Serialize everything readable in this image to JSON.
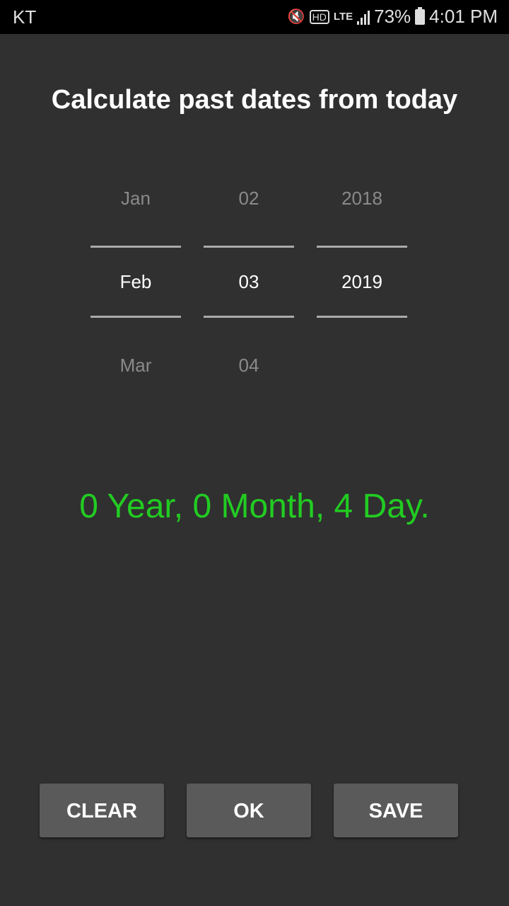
{
  "status_bar": {
    "carrier": "KT",
    "icons": [
      "mute-vibrate-icon",
      "hd-voice-icon",
      "lte-icon",
      "signal-icon",
      "battery-charging-icon"
    ],
    "hd_label": "HD",
    "network": "LTE",
    "battery": "73%",
    "time": "4:01 PM"
  },
  "title": "Calculate past dates from today",
  "picker": {
    "month": {
      "prev": "Jan",
      "selected": "Feb",
      "next": "Mar"
    },
    "day": {
      "prev": "02",
      "selected": "03",
      "next": "04"
    },
    "year": {
      "prev": "2018",
      "selected": "2019",
      "next": ""
    }
  },
  "result": "0 Year, 0 Month, 4 Day.",
  "buttons": {
    "clear": "CLEAR",
    "ok": "OK",
    "save": "SAVE"
  },
  "colors": {
    "result": "#22cc22",
    "background": "#303030",
    "button": "#5a5a5b"
  }
}
